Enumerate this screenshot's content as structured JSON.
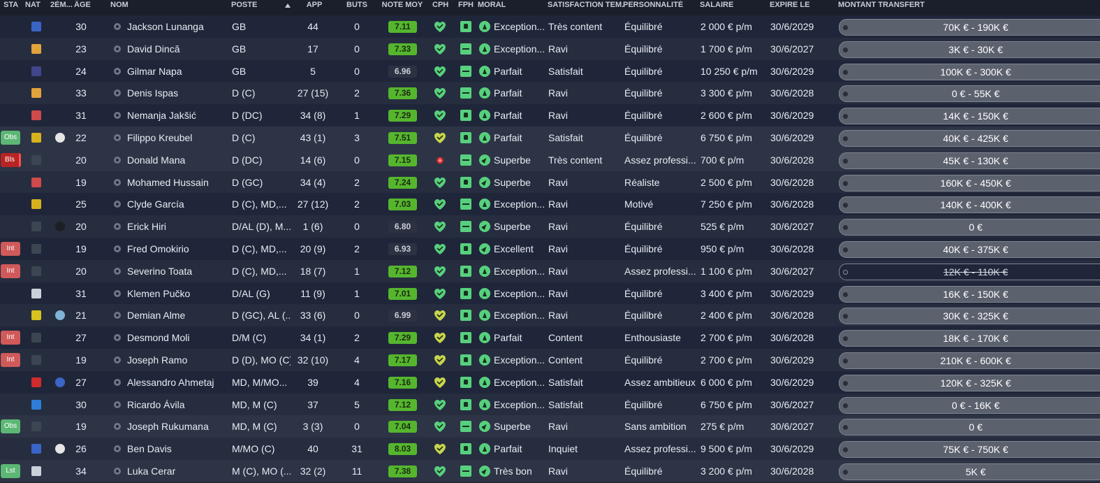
{
  "headers": {
    "sta": "STA",
    "nat": "NAT",
    "second_nat": "2ÈM...",
    "age": "ÂGE",
    "nom": "NOM",
    "poste": "POSTE",
    "app": "APP",
    "buts": "BUTS",
    "note_moy": "NOTE MOY",
    "cph": "CPH",
    "fph": "FPH",
    "moral": "MORAL",
    "satisfaction": "SATISFACTION TEM...",
    "personnalite": "PERSONNALITÉ",
    "salaire": "SALAIRE",
    "expire": "EXPIRE LE",
    "transfert": "MONTANT TRANSFERT"
  },
  "sort_indicator_icon": "sort-up-icon",
  "colors": {
    "rating_good": "#55b62e",
    "rating_avg": "#2c3242",
    "status_int": "#d05a5a",
    "status_obs": "#5cb774",
    "status_bls": "#b82323",
    "cph_green": "#57d07e",
    "cph_yellow": "#c7d44d",
    "cph_red": "#c62828"
  },
  "players": [
    {
      "sta": "",
      "nat_color": "#3a65c6",
      "second_nat": "",
      "age": "30",
      "nom": "Jackson Lunanga",
      "poste": "GB",
      "app": "44",
      "buts": "0",
      "note": "7.11",
      "note_style": "good",
      "cph": "green-heart",
      "fph": "up",
      "moral": "Exception...",
      "satisfaction": "Très content",
      "personnalite": "Équilibré",
      "salaire": "2 000 € p/m",
      "expire": "30/6/2029",
      "transfert": "70K € - 190K €",
      "strike": false
    },
    {
      "sta": "",
      "nat_color": "#e2a23c",
      "second_nat": "",
      "age": "23",
      "nom": "David Dincă",
      "poste": "GB",
      "app": "17",
      "buts": "0",
      "note": "7.33",
      "note_style": "good",
      "cph": "green-heart",
      "fph": "neutral",
      "moral": "Exception...",
      "satisfaction": "Ravi",
      "personnalite": "Équilibré",
      "salaire": "1 700 € p/m",
      "expire": "30/6/2027",
      "transfert": "3K € - 30K €",
      "strike": false
    },
    {
      "sta": "",
      "nat_color": "#41458a",
      "second_nat": "",
      "age": "24",
      "nom": "Gilmar Napa",
      "poste": "GB",
      "app": "5",
      "buts": "0",
      "note": "6.96",
      "note_style": "avg",
      "cph": "green-heart",
      "fph": "neutral",
      "moral": "Parfait",
      "satisfaction": "Satisfait",
      "personnalite": "Équilibré",
      "salaire": "10 250 € p/m",
      "expire": "30/6/2029",
      "transfert": "100K € - 300K €",
      "strike": false
    },
    {
      "sta": "",
      "nat_color": "#e2a23c",
      "second_nat": "",
      "age": "33",
      "nom": "Denis Ispas",
      "poste": "D (C)",
      "app": "27 (15)",
      "buts": "2",
      "note": "7.36",
      "note_style": "good",
      "cph": "green-heart",
      "fph": "neutral",
      "moral": "Parfait",
      "satisfaction": "Ravi",
      "personnalite": "Équilibré",
      "salaire": "3 300 € p/m",
      "expire": "30/6/2028",
      "transfert": "0 € - 55K €",
      "strike": false
    },
    {
      "sta": "",
      "nat_color": "#cf4a4a",
      "second_nat": "",
      "age": "31",
      "nom": "Nemanja Jakšić",
      "poste": "D (DC)",
      "app": "34 (8)",
      "buts": "1",
      "note": "7.29",
      "note_style": "good",
      "cph": "green-heart",
      "fph": "up",
      "moral": "Parfait",
      "satisfaction": "Ravi",
      "personnalite": "Équilibré",
      "salaire": "2 600 € p/m",
      "expire": "30/6/2029",
      "transfert": "14K € - 150K €",
      "strike": false
    },
    {
      "sta": "Obs",
      "nat_color": "#d6b21f",
      "second_nat": "#e5e5e5",
      "age": "22",
      "nom": "Filippo Kreubel",
      "poste": "D (C)",
      "app": "43 (1)",
      "buts": "3",
      "note": "7.51",
      "note_style": "good",
      "cph": "yellow-heart",
      "fph": "up",
      "moral": "Parfait",
      "satisfaction": "Satisfait",
      "personnalite": "Équilibré",
      "salaire": "6 750 € p/m",
      "expire": "30/6/2029",
      "transfert": "40K € - 425K €",
      "strike": false
    },
    {
      "sta": "Bls",
      "nat_color": "#3c4552",
      "second_nat": "",
      "age": "20",
      "nom": "Donald Mana",
      "poste": "D (DC)",
      "app": "14 (6)",
      "buts": "0",
      "note": "7.15",
      "note_style": "good",
      "cph": "red-injury",
      "fph": "neutral",
      "moral": "Superbe",
      "satisfaction": "Très content",
      "personnalite": "Assez professi...",
      "salaire": "700 € p/m",
      "expire": "30/6/2028",
      "transfert": "45K € - 130K €",
      "strike": false
    },
    {
      "sta": "",
      "nat_color": "#cf4a4a",
      "second_nat": "",
      "age": "19",
      "nom": "Mohamed Hussain",
      "poste": "D (GC)",
      "app": "34 (4)",
      "buts": "2",
      "note": "7.24",
      "note_style": "good",
      "cph": "green-heart",
      "fph": "up",
      "moral": "Superbe",
      "satisfaction": "Ravi",
      "personnalite": "Réaliste",
      "salaire": "2 500 € p/m",
      "expire": "30/6/2028",
      "transfert": "160K € - 450K €",
      "strike": false
    },
    {
      "sta": "",
      "nat_color": "#d6b21f",
      "second_nat": "",
      "age": "25",
      "nom": "Clyde García",
      "poste": "D (C), MD,...",
      "app": "27 (12)",
      "buts": "2",
      "note": "7.03",
      "note_style": "good",
      "cph": "green-heart",
      "fph": "neutral",
      "moral": "Exception...",
      "satisfaction": "Ravi",
      "personnalite": "Motivé",
      "salaire": "7 250 € p/m",
      "expire": "30/6/2028",
      "transfert": "140K € - 400K €",
      "strike": false
    },
    {
      "sta": "",
      "nat_color": "#3c4552",
      "second_nat": "#1c1f24",
      "age": "20",
      "nom": "Erick Hiri",
      "poste": "D/AL (D), M...",
      "app": "1 (6)",
      "buts": "0",
      "note": "6.80",
      "note_style": "avg",
      "cph": "green-heart",
      "fph": "neutral",
      "moral": "Superbe",
      "satisfaction": "Ravi",
      "personnalite": "Équilibré",
      "salaire": "525 € p/m",
      "expire": "30/6/2027",
      "transfert": "0 €",
      "strike": false
    },
    {
      "sta": "Int",
      "nat_color": "#3c4552",
      "second_nat": "",
      "age": "19",
      "nom": "Fred Omokirio",
      "poste": "D (C), MD,...",
      "app": "20 (9)",
      "buts": "2",
      "note": "6.93",
      "note_style": "avg",
      "cph": "green-heart",
      "fph": "up",
      "moral": "Excellent",
      "satisfaction": "Ravi",
      "personnalite": "Équilibré",
      "salaire": "950 € p/m",
      "expire": "30/6/2028",
      "transfert": "40K € - 375K €",
      "strike": false
    },
    {
      "sta": "Int",
      "nat_color": "#3c4552",
      "second_nat": "",
      "age": "20",
      "nom": "Severino Toata",
      "poste": "D (C), MD,...",
      "app": "18 (7)",
      "buts": "1",
      "note": "7.12",
      "note_style": "good",
      "cph": "green-heart",
      "fph": "up",
      "moral": "Exception...",
      "satisfaction": "Ravi",
      "personnalite": "Assez professi...",
      "salaire": "1 100 € p/m",
      "expire": "30/6/2027",
      "transfert": "12K € - 110K €",
      "strike": true
    },
    {
      "sta": "",
      "nat_color": "#c9d2da",
      "second_nat": "",
      "age": "31",
      "nom": "Klemen Pučko",
      "poste": "D/AL (G)",
      "app": "11 (9)",
      "buts": "1",
      "note": "7.01",
      "note_style": "good",
      "cph": "green-heart",
      "fph": "up",
      "moral": "Exception...",
      "satisfaction": "Ravi",
      "personnalite": "Équilibré",
      "salaire": "3 400 € p/m",
      "expire": "30/6/2029",
      "transfert": "16K € - 150K €",
      "strike": false
    },
    {
      "sta": "",
      "nat_color": "#d6c31f",
      "second_nat": "#7fb3d8",
      "age": "21",
      "nom": "Demian Alme",
      "poste": "D (GC), AL (...",
      "app": "33 (6)",
      "buts": "0",
      "note": "6.99",
      "note_style": "avg",
      "cph": "yellow-heart",
      "fph": "up",
      "moral": "Exception...",
      "satisfaction": "Ravi",
      "personnalite": "Équilibré",
      "salaire": "2 400 € p/m",
      "expire": "30/6/2028",
      "transfert": "30K € - 325K €",
      "strike": false
    },
    {
      "sta": "Int",
      "nat_color": "#3c4552",
      "second_nat": "",
      "age": "27",
      "nom": "Desmond Moli",
      "poste": "D/M (C)",
      "app": "34 (1)",
      "buts": "2",
      "note": "7.29",
      "note_style": "good",
      "cph": "yellow-heart",
      "fph": "up",
      "moral": "Parfait",
      "satisfaction": "Content",
      "personnalite": "Enthousiaste",
      "salaire": "2 700 € p/m",
      "expire": "30/6/2028",
      "transfert": "18K € - 170K €",
      "strike": false
    },
    {
      "sta": "Int",
      "nat_color": "#3c4552",
      "second_nat": "",
      "age": "19",
      "nom": "Joseph Ramo",
      "poste": "D (D), MO (C)",
      "app": "32 (10)",
      "buts": "4",
      "note": "7.17",
      "note_style": "good",
      "cph": "yellow-heart",
      "fph": "up",
      "moral": "Exception...",
      "satisfaction": "Content",
      "personnalite": "Équilibré",
      "salaire": "2 700 € p/m",
      "expire": "30/6/2029",
      "transfert": "210K € - 600K €",
      "strike": false
    },
    {
      "sta": "",
      "nat_color": "#cf2b2b",
      "second_nat": "#3a65c6",
      "age": "27",
      "nom": "Alessandro Ahmetaj",
      "poste": "MD, M/MO...",
      "app": "39",
      "buts": "4",
      "note": "7.16",
      "note_style": "good",
      "cph": "yellow-heart",
      "fph": "up",
      "moral": "Exception...",
      "satisfaction": "Satisfait",
      "personnalite": "Assez ambitieux",
      "salaire": "6 000 € p/m",
      "expire": "30/6/2029",
      "transfert": "120K € - 325K €",
      "strike": false
    },
    {
      "sta": "",
      "nat_color": "#2f7ed8",
      "second_nat": "",
      "age": "30",
      "nom": "Ricardo Ávila",
      "poste": "MD, M (C)",
      "app": "37",
      "buts": "5",
      "note": "7.12",
      "note_style": "good",
      "cph": "green-heart",
      "fph": "up",
      "moral": "Exception...",
      "satisfaction": "Satisfait",
      "personnalite": "Équilibré",
      "salaire": "6 750 € p/m",
      "expire": "30/6/2027",
      "transfert": "0 € - 16K €",
      "strike": false
    },
    {
      "sta": "Obs",
      "nat_color": "#3c4552",
      "second_nat": "",
      "age": "19",
      "nom": "Joseph Rukumana",
      "poste": "MD, M (C)",
      "app": "3 (3)",
      "buts": "0",
      "note": "7.04",
      "note_style": "good",
      "cph": "green-heart",
      "fph": "neutral",
      "moral": "Superbe",
      "satisfaction": "Ravi",
      "personnalite": "Sans ambition",
      "salaire": "275 € p/m",
      "expire": "30/6/2027",
      "transfert": "0 €",
      "strike": false
    },
    {
      "sta": "",
      "nat_color": "#3a65c6",
      "second_nat": "#e5e5e5",
      "age": "26",
      "nom": "Ben Davis",
      "poste": "M/MO (C)",
      "app": "40",
      "buts": "31",
      "note": "8.03",
      "note_style": "good",
      "cph": "yellow-heart",
      "fph": "up",
      "moral": "Parfait",
      "satisfaction": "Inquiet",
      "personnalite": "Assez professi...",
      "salaire": "9 500 € p/m",
      "expire": "30/6/2029",
      "transfert": "75K € - 750K €",
      "strike": false
    },
    {
      "sta": "Lst",
      "nat_color": "#c9d2da",
      "second_nat": "",
      "age": "34",
      "nom": "Luka Cerar",
      "poste": "M (C), MO (...",
      "app": "32 (2)",
      "buts": "11",
      "note": "7.38",
      "note_style": "good",
      "cph": "green-heart",
      "fph": "neutral",
      "moral": "Très bon",
      "satisfaction": "Ravi",
      "personnalite": "Équilibré",
      "salaire": "3 200 € p/m",
      "expire": "30/6/2028",
      "transfert": "5K €",
      "strike": false
    }
  ]
}
